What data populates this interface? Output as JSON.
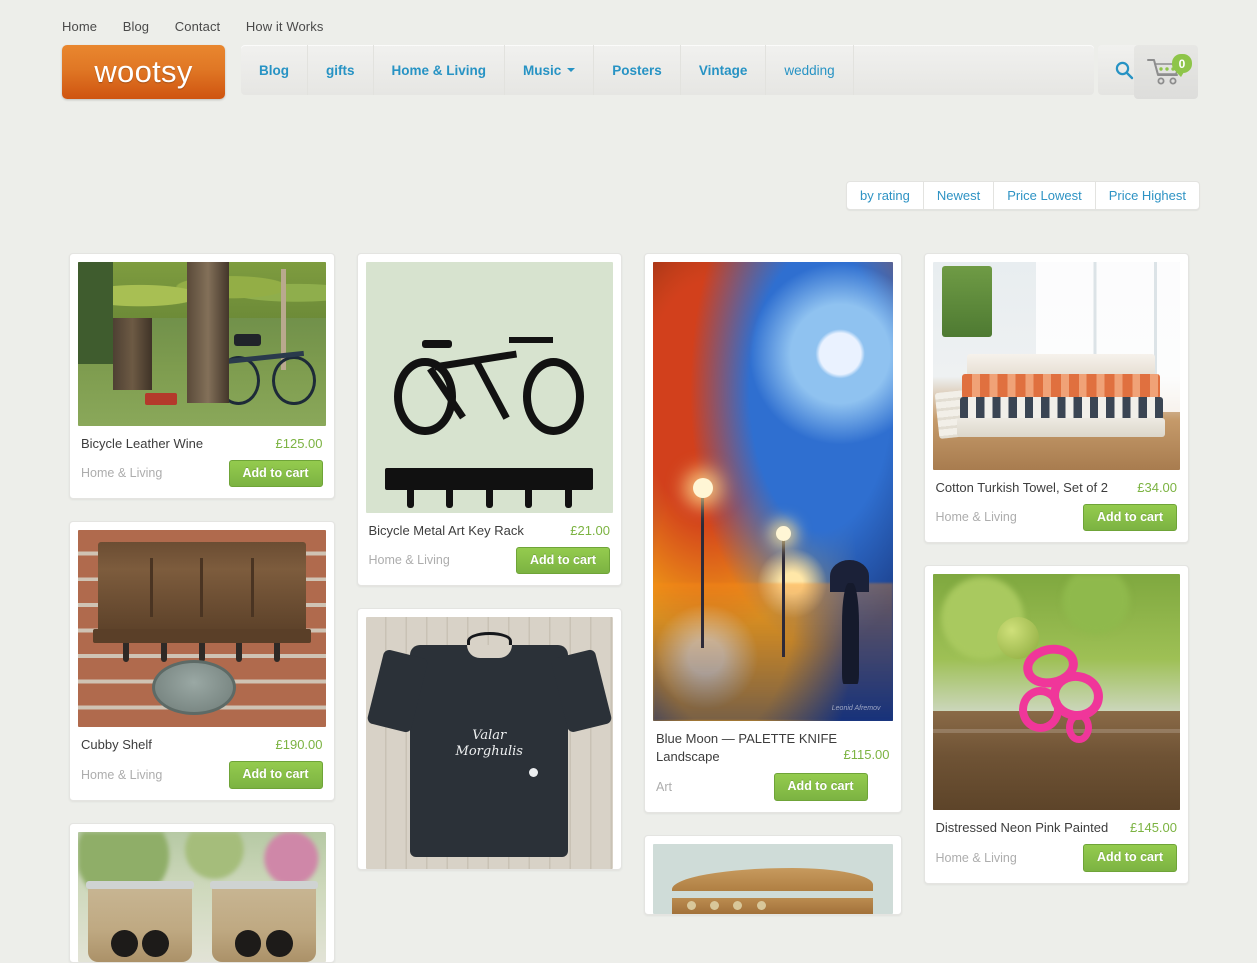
{
  "top_nav": {
    "items": [
      {
        "label": "Home"
      },
      {
        "label": "Blog"
      },
      {
        "label": "Contact"
      },
      {
        "label": "How it Works"
      }
    ]
  },
  "header": {
    "logo_text": "wootsy",
    "logo_gradient_from": "#e9872f",
    "logo_gradient_to": "#cf5410",
    "nav_items": [
      {
        "label": "Blog",
        "bold": true,
        "has_caret": false
      },
      {
        "label": "gifts",
        "bold": true,
        "has_caret": false
      },
      {
        "label": "Home & Living",
        "bold": true,
        "has_caret": false
      },
      {
        "label": "Music",
        "bold": true,
        "has_caret": true
      },
      {
        "label": "Posters",
        "bold": true,
        "has_caret": false
      },
      {
        "label": "Vintage",
        "bold": true,
        "has_caret": false
      },
      {
        "label": "wedding",
        "bold": false,
        "has_caret": false
      }
    ],
    "nav_link_color": "#2793c4",
    "search_icon": "search-icon",
    "cart_icon": "shopping-cart-icon",
    "cart_count": "0",
    "cart_badge_color": "#8ec549"
  },
  "sort_bar": {
    "options": [
      {
        "label": "by rating"
      },
      {
        "label": "Newest"
      },
      {
        "label": "Price Lowest"
      },
      {
        "label": "Price Highest"
      }
    ],
    "link_color": "#2e93c4"
  },
  "products": {
    "add_to_cart_label": "Add to cart",
    "price_color": "#7cb342",
    "columns": [
      {
        "items": [
          {
            "title": "Bicycle Leather Wine",
            "price": "£125.00",
            "category": "Home & Living",
            "image": "bicycle-leaning-on-tree-in-park-photo",
            "partial": false
          },
          {
            "title": "Cubby Shelf",
            "price": "£190.00",
            "category": "Home & Living",
            "image": "wooden-cubby-shelf-on-brick-wall-photo",
            "partial": false
          },
          {
            "title": "",
            "price": "",
            "category": "",
            "image": "pair-of-mouse-ear-planter-pots-photo",
            "partial": true
          }
        ]
      },
      {
        "items": [
          {
            "title": "Bicycle Metal Art Key Rack",
            "price": "£21.00",
            "category": "Home & Living",
            "image": "black-bicycle-silhouette-key-rack-photo",
            "partial": false
          },
          {
            "title": "",
            "price": "",
            "category": "",
            "image": "navy-graphic-tshirt-on-fence-photo",
            "partial": true
          }
        ]
      },
      {
        "items": [
          {
            "title": "Blue Moon — PALETTE KNIFE Landscape",
            "price": "£115.00",
            "category": "Art",
            "image": "blue-moon-palette-knife-painting",
            "partial": false,
            "overlap_price": true
          },
          {
            "title": "",
            "price": "",
            "category": "",
            "image": "wooden-wall-shelf-photo",
            "partial": true
          }
        ]
      },
      {
        "items": [
          {
            "title": "Cotton Turkish Towel, Set of 2",
            "price": "£34.00",
            "category": "Home & Living",
            "image": "stacked-cotton-turkish-towels-photo",
            "partial": false
          },
          {
            "title": "Distressed Neon Pink Painted",
            "price": "£145.00",
            "category": "Home & Living",
            "image": "neon-pink-ornate-hook-on-wood-photo",
            "partial": false
          }
        ]
      }
    ]
  }
}
